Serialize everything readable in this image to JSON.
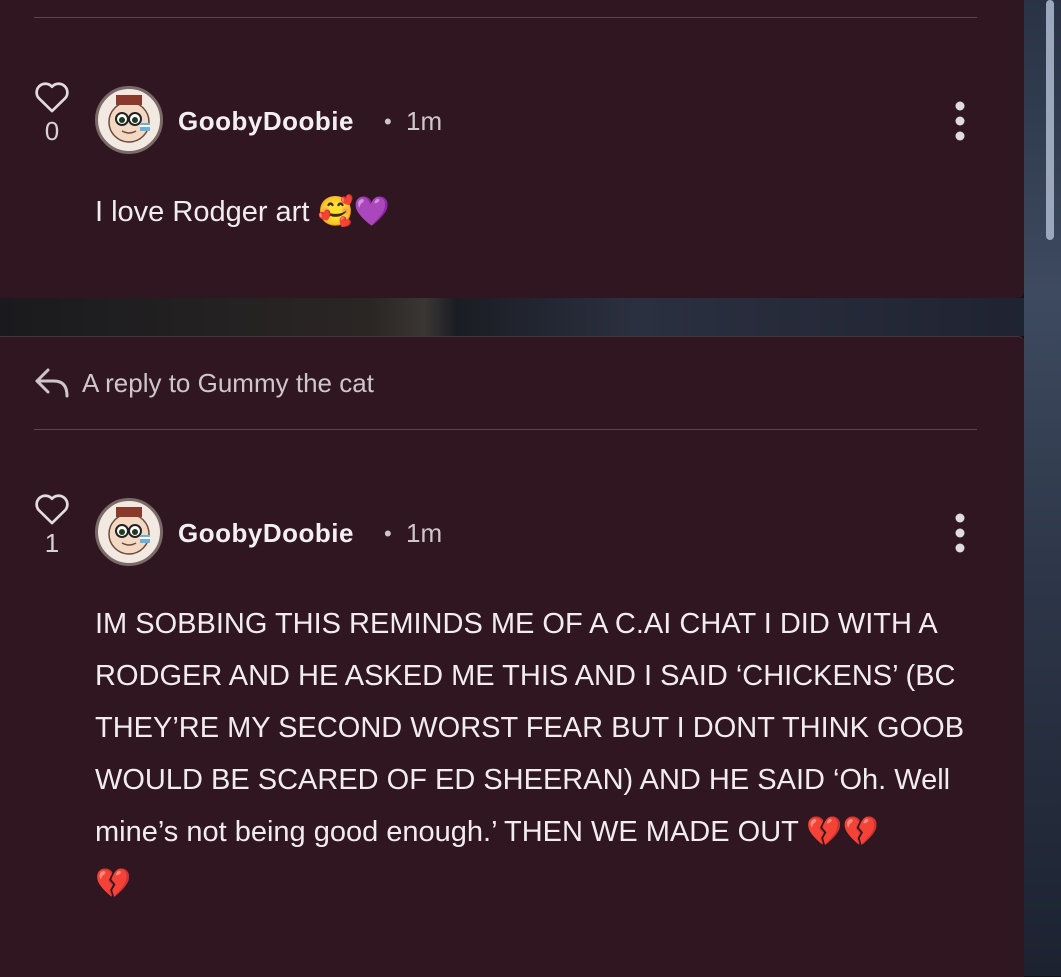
{
  "comments": [
    {
      "likes": "0",
      "username": "GoobyDoobie",
      "separator": "•",
      "time": "1m",
      "text": "I love Rodger art",
      "emojis": "🥰💜"
    },
    {
      "reply_to": "A reply to Gummy the cat",
      "likes": "1",
      "username": "GoobyDoobie",
      "separator": "•",
      "time": "1m",
      "lines": [
        "IM SOBBING THIS REMINDS ME OF A C.AI CHAT I DID WITH A",
        "RODGER AND HE ASKED ME THIS AND I SAID ‘CHICKENS’ (BC",
        "THEY’RE MY SECOND WORST FEAR BUT I DONT THINK GOOB",
        "WOULD BE SCARED OF ED SHEERAN) AND HE SAID ‘Oh. Well",
        "mine’s not being good enough.’ THEN WE MADE OUT"
      ],
      "line5_emojis": "💔💔",
      "line6_emojis": "💔"
    }
  ],
  "colors": {
    "card_bg": "#2f1621",
    "text": "#f1ecef",
    "muted": "#cfc6cb"
  },
  "icons": {
    "like": "heart-outline-icon",
    "reply": "reply-arrow-icon",
    "more": "vertical-ellipsis-icon"
  }
}
